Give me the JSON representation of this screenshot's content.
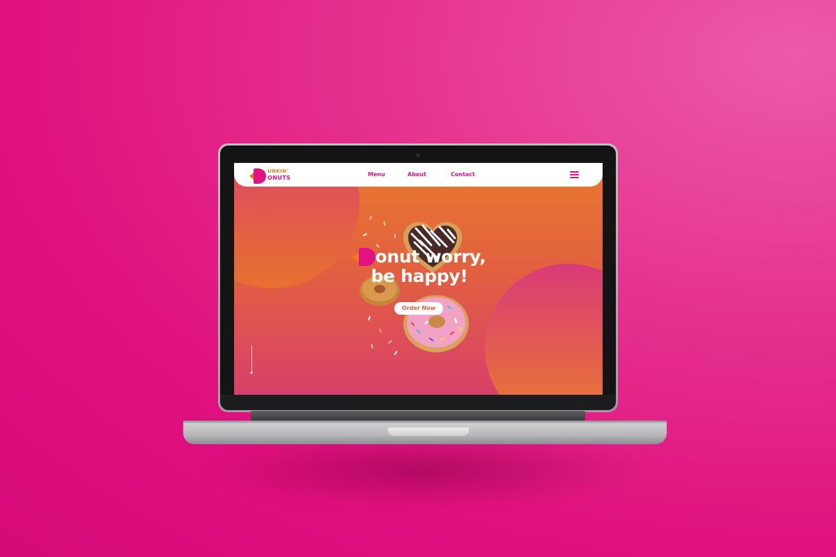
{
  "brand": {
    "logo_line1": "UNKIN'",
    "logo_line2": "ONUTS",
    "logo_initial": "D",
    "primary_color": "#e11383",
    "accent_color": "#f27a1a"
  },
  "nav": {
    "links": [
      "Menu",
      "About",
      "Contact"
    ],
    "menu_icon": "hamburger-icon"
  },
  "hero": {
    "headline_initial": "D",
    "headline_line1_rest": "onut worry,",
    "headline_line2": "be happy!",
    "cta_label": "Order Now",
    "scroll_icon": "scroll-down-arrow-icon"
  },
  "colors": {
    "background": "#e0107f",
    "hero_gradient_top": "#e9782f",
    "hero_gradient_bottom": "#d8406a"
  }
}
